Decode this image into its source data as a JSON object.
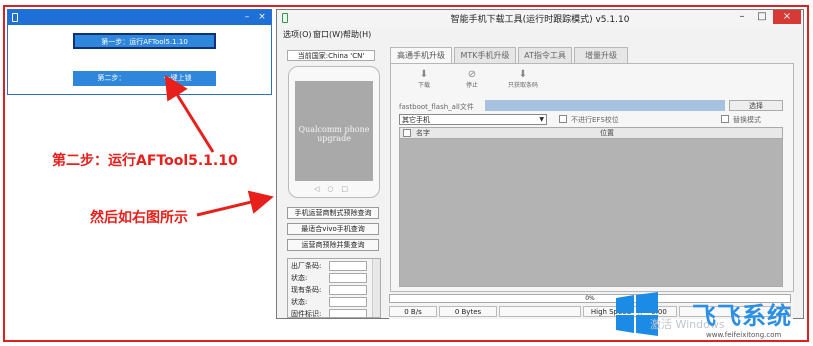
{
  "mini_window": {
    "step1_label": "第一步：运行AFTool5.1.10",
    "step2_label": "第二步：",
    "step2_suffix": "一键上锁",
    "close_glyph": "×",
    "minimize_glyph": "–"
  },
  "annotations": {
    "step2_text": "第二步：运行AFTool5.1.10",
    "then_text": "然后如右图所示"
  },
  "main_window": {
    "title": "智能手机下载工具(运行时跟踪模式)  v5.1.10",
    "controls": {
      "minimize": "–",
      "maximize": "□",
      "close": "×"
    },
    "menu": [
      "选项(O)",
      "窗口(W)",
      "帮助(H)"
    ],
    "country": "当前国家:China 'CN'",
    "phone_screen_text": [
      "Qualcomm phone",
      "upgrade"
    ],
    "side_buttons": [
      "手机运营商制式预除查询",
      "最适合vivo手机查询",
      "运营商预除并集查询"
    ],
    "info_labels": [
      "出厂条码:",
      "状态:",
      "现有条码:",
      "状态:",
      "固件标识:"
    ],
    "tabs": [
      "高通手机升级",
      "MTK手机升级",
      "AT指令工具",
      "增量升级"
    ],
    "active_tab": 0,
    "toolbar": [
      {
        "icon": "download-icon",
        "glyph": "⬇",
        "label": "下载"
      },
      {
        "icon": "stop-icon",
        "glyph": "⊘",
        "label": "停止"
      },
      {
        "icon": "fetch-icon",
        "glyph": "⬇",
        "label": "只获取条码"
      }
    ],
    "fastboot_label": "fastboot_flash_all文件",
    "browse_button": "选择",
    "model_select": "其它手机",
    "no_efs_label": "不进行EFS校位",
    "ota_label": "替换模式",
    "grid_headers": [
      "名字",
      "位置"
    ],
    "progress_text": "0%",
    "stats": [
      "0 B/s",
      "0 Bytes",
      "",
      "High Speed",
      "0:00",
      ""
    ]
  },
  "watermark": {
    "brand": "飞飞系统",
    "win_text": "激活 Windows",
    "url": "www.feifeixitong.com"
  },
  "colors": {
    "annotation_red": "#e8201c",
    "title_blue": "#1e6fd6",
    "button_blue": "#2f87dc",
    "close_red": "#d73a35"
  }
}
